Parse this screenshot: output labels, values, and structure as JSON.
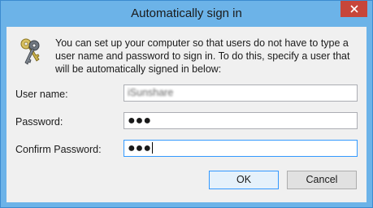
{
  "window": {
    "title": "Automatically sign in"
  },
  "description": "You can set up your computer so that users do not have to type a user name and password to sign in. To do this, specify a user that will be automatically signed in below:",
  "fields": {
    "user_name": {
      "label": "User name:",
      "value": "iSunshare"
    },
    "password": {
      "label": "Password:",
      "value": "●●●"
    },
    "confirm_password": {
      "label": "Confirm Password:",
      "value": "●●●"
    }
  },
  "buttons": {
    "ok": "OK",
    "cancel": "Cancel"
  },
  "icons": {
    "header": "keys-icon",
    "close": "close-icon"
  },
  "colors": {
    "title_bar": "#6cb3e8",
    "close_button": "#c7463a",
    "dialog_bg": "#f0f0f0",
    "focus_border": "#3399ff"
  }
}
